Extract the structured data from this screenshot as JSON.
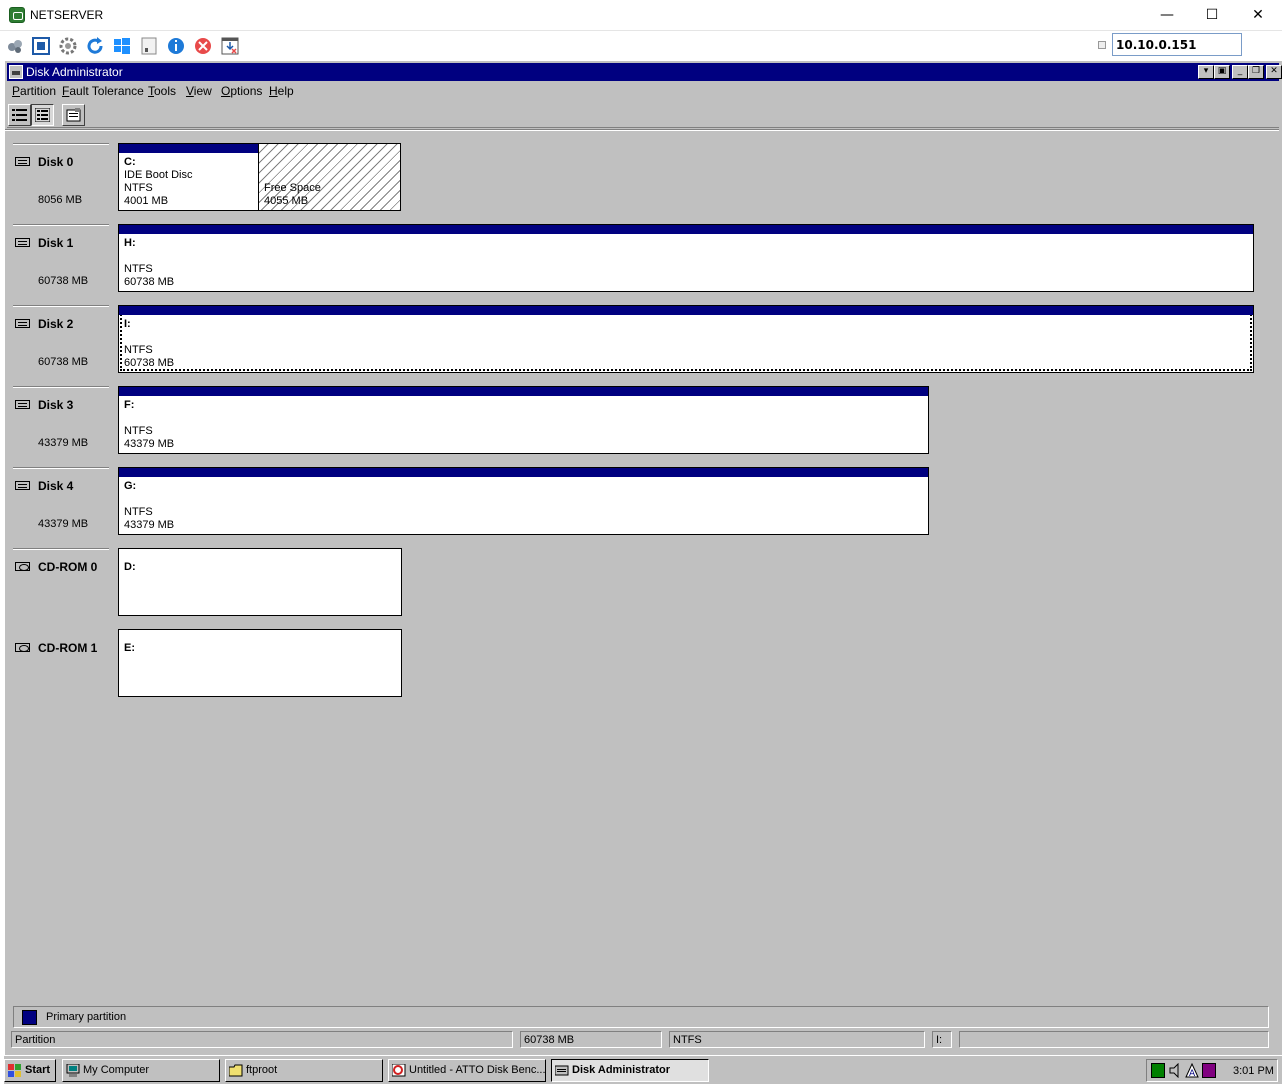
{
  "host": {
    "title": "NETSERVER",
    "address": "10.10.0.151",
    "window_controls": {
      "minimize": "—",
      "maximize": "☐",
      "close": "✕"
    }
  },
  "window": {
    "title": "Disk Administrator",
    "caption_buttons": [
      "▾",
      "▣",
      "_",
      "❐",
      "✕"
    ]
  },
  "menu": [
    {
      "label": "Partition",
      "accel": "P"
    },
    {
      "label": "Fault Tolerance",
      "accel": "F"
    },
    {
      "label": "Tools",
      "accel": "T"
    },
    {
      "label": "View",
      "accel": "V"
    },
    {
      "label": "Options",
      "accel": "O"
    },
    {
      "label": "Help",
      "accel": "H"
    }
  ],
  "disks": [
    {
      "name": "Disk 0",
      "size": "8056 MB",
      "partitions": [
        {
          "letter": "C:",
          "label": "IDE Boot Disc",
          "fs": "NTFS",
          "size": "4001 MB"
        },
        {
          "free": true,
          "label": "Free Space",
          "size": "4055 MB"
        }
      ]
    },
    {
      "name": "Disk 1",
      "size": "60738 MB",
      "partitions": [
        {
          "letter": "H:",
          "fs": "NTFS",
          "size": "60738 MB"
        }
      ]
    },
    {
      "name": "Disk 2",
      "size": "60738 MB",
      "partitions": [
        {
          "letter": "I:",
          "fs": "NTFS",
          "size": "60738 MB",
          "selected": true
        }
      ]
    },
    {
      "name": "Disk 3",
      "size": "43379 MB",
      "partitions": [
        {
          "letter": "F:",
          "fs": "NTFS",
          "size": "43379 MB"
        }
      ]
    },
    {
      "name": "Disk 4",
      "size": "43379 MB",
      "partitions": [
        {
          "letter": "G:",
          "fs": "NTFS",
          "size": "43379 MB"
        }
      ]
    },
    {
      "name": "CD-ROM 0",
      "cdrom": true,
      "partitions": [
        {
          "letter": "D:"
        }
      ]
    },
    {
      "name": "CD-ROM 1",
      "cdrom": true,
      "partitions": [
        {
          "letter": "E:"
        }
      ]
    }
  ],
  "legend": {
    "primary_label": "Primary partition",
    "primary_color": "#000080"
  },
  "status": {
    "type": "Partition",
    "size": "60738 MB",
    "fs": "NTFS",
    "drive": "I:"
  },
  "taskbar": {
    "start": "Start",
    "items": [
      "My Computer",
      "ftproot",
      "Untitled - ATTO Disk Benc...",
      "Disk Administrator"
    ],
    "clock": "3:01 PM"
  }
}
